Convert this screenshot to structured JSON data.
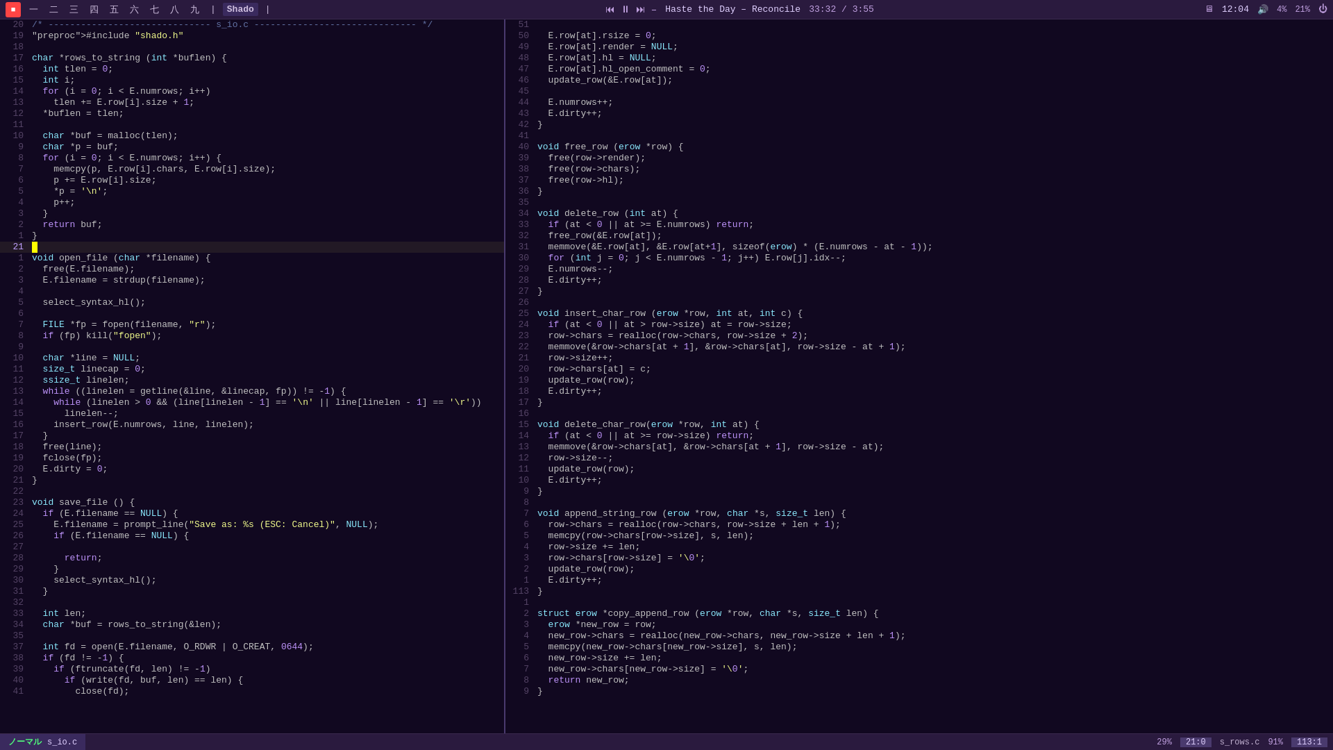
{
  "topbar": {
    "icon_label": "■",
    "menu_items": [
      "一",
      "二",
      "三",
      "四",
      "五",
      "六",
      "七",
      "八",
      "九"
    ],
    "separator": "|",
    "shado_label": "Shado",
    "separator2": "|",
    "player": {
      "prev": "⏮",
      "play_pause": "⏸",
      "next": "⏭",
      "indicator": "–",
      "song": "Haste the Day – Reconcile",
      "time_current": "33:32",
      "time_sep": "/",
      "time_total": "3:55"
    },
    "right": {
      "monitor_icon": "🖥",
      "clock": "12:04",
      "volume_icon": "🔊",
      "battery": "4%",
      "brightness": "21%",
      "power_icon": "⏻"
    }
  },
  "left_pane": {
    "filename": "s_io.c",
    "mode": "ノーマル",
    "percent": "29%",
    "position": "21:0",
    "lines": [
      {
        "num": "20",
        "content": "/* ------------------------------ s_io.c ------------------------------ */",
        "type": "comment"
      },
      {
        "num": "19",
        "content": "#include \"shado.h\"",
        "type": "preproc"
      },
      {
        "num": "18",
        "content": ""
      },
      {
        "num": "17",
        "content": "char *rows_to_string (int *buflen) {",
        "type": "fn"
      },
      {
        "num": "16",
        "content": "  int tlen = 0;",
        "type": "code"
      },
      {
        "num": "15",
        "content": "  int i;",
        "type": "code"
      },
      {
        "num": "14",
        "content": "  for (i = 0; i < E.numrows; i++)",
        "type": "code"
      },
      {
        "num": "13",
        "content": "    tlen += E.row[i].size + 1;",
        "type": "code"
      },
      {
        "num": "12",
        "content": "  *buflen = tlen;",
        "type": "code"
      },
      {
        "num": "11",
        "content": ""
      },
      {
        "num": "10",
        "content": "  char *buf = malloc(tlen);",
        "type": "code"
      },
      {
        "num": "9",
        "content": "  char *p = buf;",
        "type": "code"
      },
      {
        "num": "8",
        "content": "  for (i = 0; i < E.numrows; i++) {",
        "type": "code"
      },
      {
        "num": "7",
        "content": "    memcpy(p, E.row[i].chars, E.row[i].size);",
        "type": "code"
      },
      {
        "num": "6",
        "content": "    p += E.row[i].size;",
        "type": "code"
      },
      {
        "num": "5",
        "content": "    *p = '\\n';",
        "type": "code"
      },
      {
        "num": "4",
        "content": "    p++;",
        "type": "code"
      },
      {
        "num": "3",
        "content": "  }"
      },
      {
        "num": "2",
        "content": "  return buf;",
        "type": "code"
      },
      {
        "num": "1",
        "content": "}"
      },
      {
        "num": "21",
        "content": "",
        "current": true
      },
      {
        "num": "1",
        "content": "void open_file (char *filename) {",
        "type": "fn"
      },
      {
        "num": "2",
        "content": "  free(E.filename);",
        "type": "code"
      },
      {
        "num": "3",
        "content": "  E.filename = strdup(filename);",
        "type": "code"
      },
      {
        "num": "4",
        "content": ""
      },
      {
        "num": "5",
        "content": "  select_syntax_hl();",
        "type": "code"
      },
      {
        "num": "6",
        "content": ""
      },
      {
        "num": "7",
        "content": "  FILE *fp = fopen(filename, \"r\");",
        "type": "code"
      },
      {
        "num": "8",
        "content": "  if (fp) kill(\"fopen\");",
        "type": "code"
      },
      {
        "num": "9",
        "content": ""
      },
      {
        "num": "10",
        "content": "  char *line = NULL;",
        "type": "code"
      },
      {
        "num": "11",
        "content": "  size_t linecap = 0;",
        "type": "code"
      },
      {
        "num": "12",
        "content": "  ssize_t linelen;",
        "type": "code"
      },
      {
        "num": "13",
        "content": "  while ((linelen = getline(&line, &linecap, fp)) != -1) {",
        "type": "code"
      },
      {
        "num": "14",
        "content": "    while (linelen > 0 && (line[linelen - 1] == '\\n' || line[linelen - 1] == '\\r'))",
        "type": "code"
      },
      {
        "num": "15",
        "content": "      linelen--;",
        "type": "code"
      },
      {
        "num": "16",
        "content": "    insert_row(E.numrows, line, linelen);",
        "type": "code"
      },
      {
        "num": "17",
        "content": "  }"
      },
      {
        "num": "18",
        "content": "  free(line);",
        "type": "code"
      },
      {
        "num": "19",
        "content": "  fclose(fp);",
        "type": "code"
      },
      {
        "num": "20",
        "content": "  E.dirty = 0;",
        "type": "code"
      },
      {
        "num": "21",
        "content": "}"
      },
      {
        "num": "22",
        "content": ""
      },
      {
        "num": "23",
        "content": "void save_file () {",
        "type": "fn"
      },
      {
        "num": "24",
        "content": "  if (E.filename == NULL) {",
        "type": "code"
      },
      {
        "num": "25",
        "content": "    E.filename = prompt_line(\"Save as: %s (ESC: Cancel)\", NULL);",
        "type": "code"
      },
      {
        "num": "26",
        "content": "    if (E.filename == NULL) {",
        "type": "code"
      },
      {
        "num": "27",
        "content": ""
      },
      {
        "num": "28",
        "content": "      return;",
        "type": "code"
      },
      {
        "num": "29",
        "content": "    }"
      },
      {
        "num": "30",
        "content": "    select_syntax_hl();",
        "type": "code"
      },
      {
        "num": "31",
        "content": "  }"
      },
      {
        "num": "32",
        "content": ""
      },
      {
        "num": "33",
        "content": "  int len;",
        "type": "code"
      },
      {
        "num": "34",
        "content": "  char *buf = rows_to_string(&len);",
        "type": "code"
      },
      {
        "num": "35",
        "content": ""
      },
      {
        "num": "37",
        "content": "  int fd = open(E.filename, O_RDWR | O_CREAT, 0644);",
        "type": "code"
      },
      {
        "num": "38",
        "content": "  if (fd != -1) {",
        "type": "code"
      },
      {
        "num": "39",
        "content": "    if (ftruncate(fd, len) != -1)",
        "type": "code"
      },
      {
        "num": "40",
        "content": "      if (write(fd, buf, len) == len) {",
        "type": "code"
      },
      {
        "num": "41",
        "content": "        close(fd);",
        "type": "code"
      }
    ]
  },
  "right_pane": {
    "filename": "s_rows.c",
    "percent": "91%",
    "position": "113:1",
    "lines": [
      {
        "num": "51",
        "content": ""
      },
      {
        "num": "50",
        "content": "  E.row[at].rsize = 0;"
      },
      {
        "num": "49",
        "content": "  E.row[at].render = NULL;"
      },
      {
        "num": "48",
        "content": "  E.row[at].hl = NULL;"
      },
      {
        "num": "47",
        "content": "  E.row[at].hl_open_comment = 0;"
      },
      {
        "num": "46",
        "content": "  update_row(&E.row[at]);"
      },
      {
        "num": "45",
        "content": ""
      },
      {
        "num": "44",
        "content": "  E.numrows++;"
      },
      {
        "num": "43",
        "content": "  E.dirty++;"
      },
      {
        "num": "42",
        "content": "}"
      },
      {
        "num": "41",
        "content": ""
      },
      {
        "num": "40",
        "content": "void free_row (erow *row) {"
      },
      {
        "num": "39",
        "content": "  free(row->render);"
      },
      {
        "num": "38",
        "content": "  free(row->chars);"
      },
      {
        "num": "37",
        "content": "  free(row->hl);"
      },
      {
        "num": "36",
        "content": "}"
      },
      {
        "num": "35",
        "content": ""
      },
      {
        "num": "34",
        "content": "void delete_row (int at) {"
      },
      {
        "num": "33",
        "content": "  if (at < 0 || at >= E.numrows) return;"
      },
      {
        "num": "32",
        "content": "  free_row(&E.row[at]);"
      },
      {
        "num": "31",
        "content": "  memmove(&E.row[at], &E.row[at+1], sizeof(erow) * (E.numrows - at - 1));"
      },
      {
        "num": "30",
        "content": "  for (int j = 0; j < E.numrows - 1; j++) E.row[j].idx--;"
      },
      {
        "num": "29",
        "content": "  E.numrows--;"
      },
      {
        "num": "28",
        "content": "  E.dirty++;"
      },
      {
        "num": "27",
        "content": "}"
      },
      {
        "num": "26",
        "content": ""
      },
      {
        "num": "25",
        "content": "void insert_char_row (erow *row, int at, int c) {"
      },
      {
        "num": "24",
        "content": "  if (at < 0 || at > row->size) at = row->size;"
      },
      {
        "num": "23",
        "content": "  row->chars = realloc(row->chars, row->size + 2);"
      },
      {
        "num": "22",
        "content": "  memmove(&row->chars[at + 1], &row->chars[at], row->size - at + 1);"
      },
      {
        "num": "21",
        "content": "  row->size++;"
      },
      {
        "num": "20",
        "content": "  row->chars[at] = c;"
      },
      {
        "num": "19",
        "content": "  update_row(row);"
      },
      {
        "num": "18",
        "content": "  E.dirty++;"
      },
      {
        "num": "17",
        "content": "}"
      },
      {
        "num": "16",
        "content": ""
      },
      {
        "num": "15",
        "content": "void delete_char_row(erow *row, int at) {"
      },
      {
        "num": "14",
        "content": "  if (at < 0 || at >= row->size) return;"
      },
      {
        "num": "13",
        "content": "  memmove(&row->chars[at], &row->chars[at + 1], row->size - at);"
      },
      {
        "num": "12",
        "content": "  row->size--;"
      },
      {
        "num": "11",
        "content": "  update_row(row);"
      },
      {
        "num": "10",
        "content": "  E.dirty++;"
      },
      {
        "num": "9",
        "content": "}"
      },
      {
        "num": "8",
        "content": ""
      },
      {
        "num": "7",
        "content": "void append_string_row (erow *row, char *s, size_t len) {"
      },
      {
        "num": "6",
        "content": "  row->chars = realloc(row->chars, row->size + len + 1);"
      },
      {
        "num": "5",
        "content": "  memcpy(row->chars[row->size], s, len);"
      },
      {
        "num": "4",
        "content": "  row->size += len;"
      },
      {
        "num": "3",
        "content": "  row->chars[row->size] = '\\0';"
      },
      {
        "num": "2",
        "content": "  update_row(row);"
      },
      {
        "num": "1",
        "content": "  E.dirty++;"
      },
      {
        "num": "113",
        "content": "}"
      },
      {
        "num": "1",
        "content": ""
      },
      {
        "num": "2",
        "content": "struct erow *copy_append_row (erow *row, char *s, size_t len) {"
      },
      {
        "num": "3",
        "content": "  erow *new_row = row;"
      },
      {
        "num": "4",
        "content": "  new_row->chars = realloc(new_row->chars, new_row->size + len + 1);"
      },
      {
        "num": "5",
        "content": "  memcpy(new_row->chars[new_row->size], s, len);"
      },
      {
        "num": "6",
        "content": "  new_row->size += len;"
      },
      {
        "num": "7",
        "content": "  new_row->chars[new_row->size] = '\\0';"
      },
      {
        "num": "8",
        "content": "  return new_row;"
      },
      {
        "num": "9",
        "content": "}"
      }
    ]
  },
  "statusbar": {
    "left_mode": "ノーマル",
    "left_file": "s_io.c",
    "right_percent": "29%",
    "right_position": "21:0",
    "right_file": "s_rows.c",
    "right_pct2": "91%",
    "right_pos2": "113:1"
  }
}
